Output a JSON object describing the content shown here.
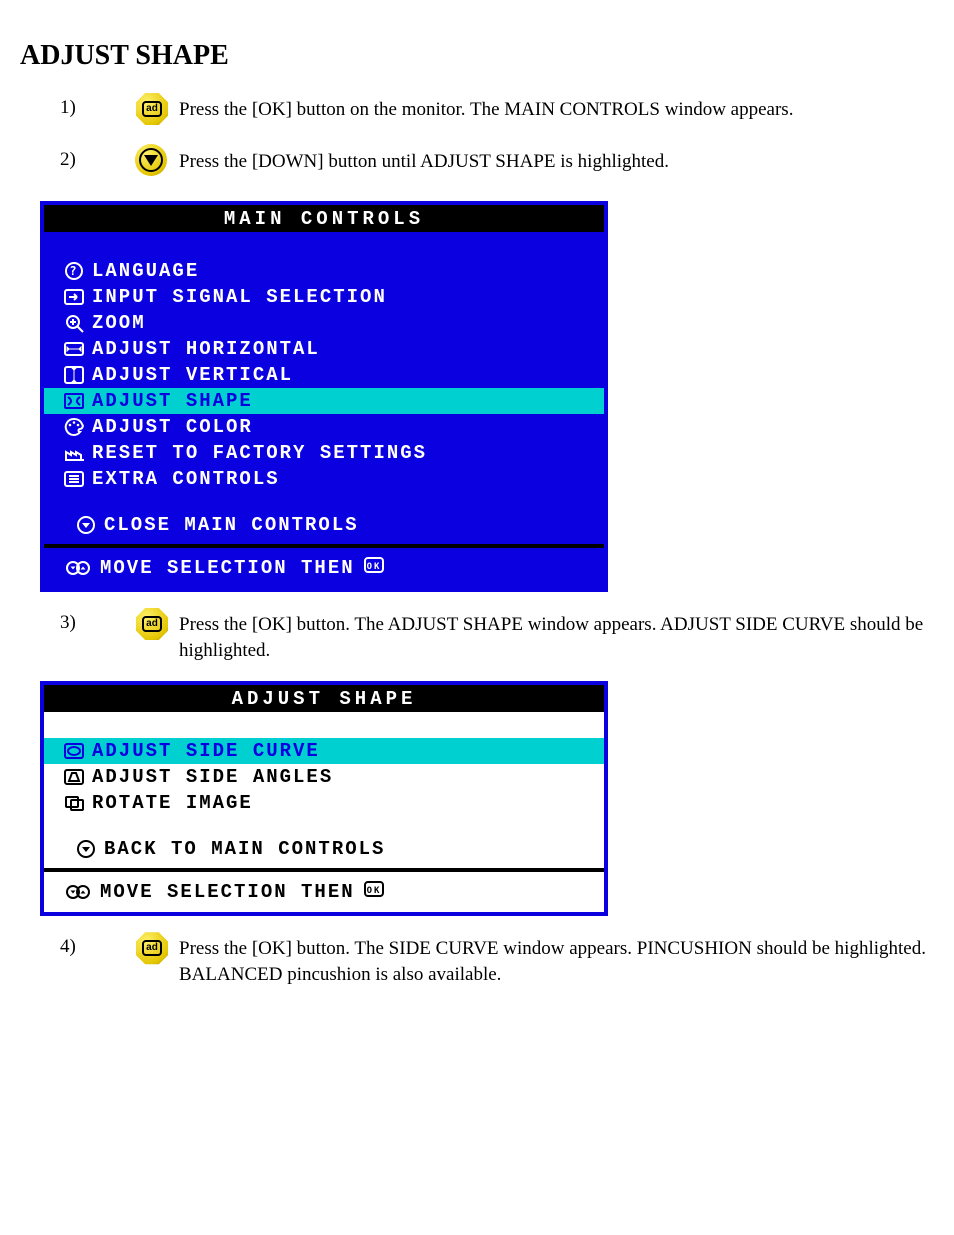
{
  "heading": "ADJUST SHAPE",
  "steps": {
    "s1": {
      "num": "1)",
      "text": "Press the [OK] button on the monitor. The MAIN CONTROLS window appears."
    },
    "s2": {
      "num": "2)",
      "text": "Press the [DOWN] button until ADJUST SHAPE is highlighted."
    },
    "s3": {
      "num": "3)",
      "text": "Press the [OK] button. The ADJUST SHAPE window appears. ADJUST SIDE CURVE should be highlighted."
    },
    "s4": {
      "num": "4)",
      "text": "Press the [OK] button. The SIDE CURVE window appears. PINCUSHION should be highlighted. BALANCED pincushion is also available."
    }
  },
  "main_panel": {
    "title": "MAIN CONTROLS",
    "items": [
      {
        "iconId": "globe-question-icon",
        "label": "LANGUAGE",
        "highlight": false
      },
      {
        "iconId": "input-arrow-icon",
        "label": "INPUT SIGNAL SELECTION",
        "highlight": false
      },
      {
        "iconId": "magnify-plus-icon",
        "label": "ZOOM",
        "highlight": false
      },
      {
        "iconId": "horizontal-arrows-icon",
        "label": "ADJUST HORIZONTAL",
        "highlight": false
      },
      {
        "iconId": "vertical-arrows-icon",
        "label": "ADJUST VERTICAL",
        "highlight": false
      },
      {
        "iconId": "shape-icon",
        "label": "ADJUST SHAPE",
        "highlight": true
      },
      {
        "iconId": "palette-icon",
        "label": "ADJUST COLOR",
        "highlight": false
      },
      {
        "iconId": "factory-icon",
        "label": "RESET TO FACTORY SETTINGS",
        "highlight": false
      },
      {
        "iconId": "list-icon",
        "label": "EXTRA CONTROLS",
        "highlight": false
      }
    ],
    "close": {
      "iconId": "circle-down-icon",
      "label": "CLOSE MAIN CONTROLS"
    },
    "footer": {
      "text": "MOVE SELECTION THEN",
      "ok": "OK"
    }
  },
  "shape_panel": {
    "title": "ADJUST SHAPE",
    "items": [
      {
        "iconId": "pincushion-icon",
        "label": "ADJUST SIDE CURVE",
        "highlight": true
      },
      {
        "iconId": "trapezoid-icon",
        "label": "ADJUST SIDE ANGLES",
        "highlight": false
      },
      {
        "iconId": "rotate-icon",
        "label": "ROTATE IMAGE",
        "highlight": false
      }
    ],
    "back": {
      "iconId": "circle-down-icon",
      "label": "BACK TO MAIN CONTROLS"
    },
    "footer": {
      "text": "MOVE SELECTION THEN",
      "ok": "OK"
    }
  }
}
